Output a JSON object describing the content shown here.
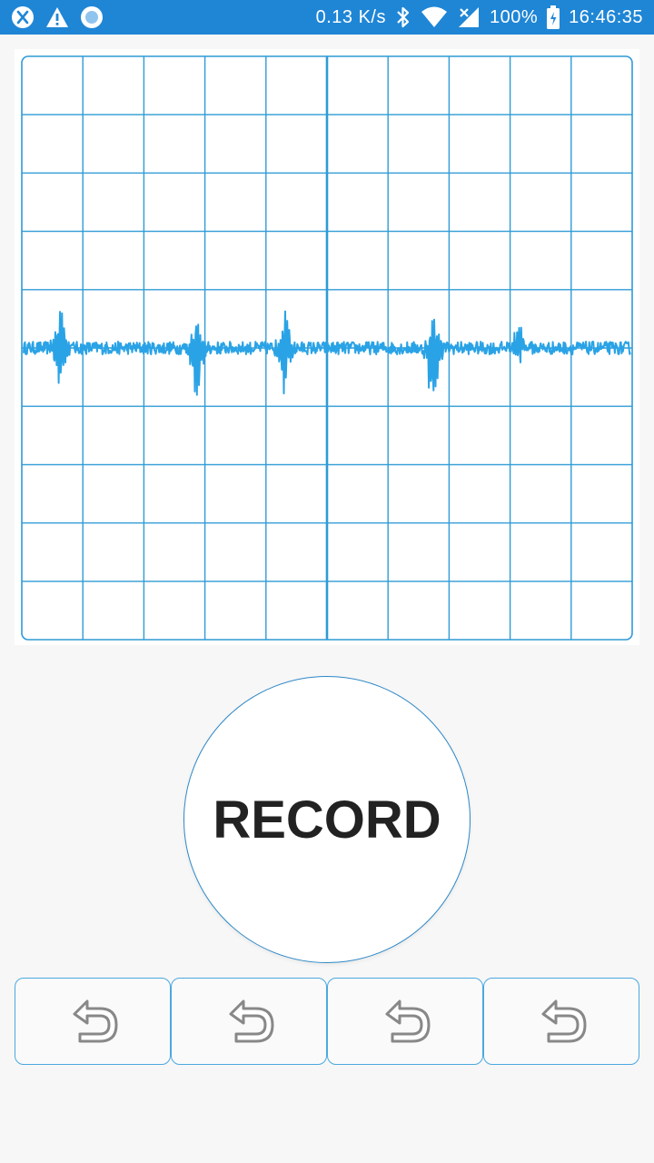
{
  "status_bar": {
    "left_icons": [
      "app-badge-icon",
      "warning-icon",
      "record-dot-icon"
    ],
    "network_speed": "0.13 K/s",
    "right_icons": [
      "bluetooth-icon",
      "wifi-icon",
      "signal-icon"
    ],
    "battery": "100%",
    "time": "16:46:35",
    "color": "#1f86d6"
  },
  "oscilloscope": {
    "grid_columns": 10,
    "grid_rows": 10,
    "trace_color": "#2aa3e6",
    "grid_color": "#2e9bd6",
    "spikes": [
      {
        "t": 0.06,
        "up": 0.78,
        "down": 0.62
      },
      {
        "t": 0.285,
        "up": 0.47,
        "down": 1.15
      },
      {
        "t": 0.43,
        "up": 0.64,
        "down": 0.58
      },
      {
        "t": 0.675,
        "up": 0.45,
        "down": 1.22
      },
      {
        "t": 0.815,
        "up": 0.45,
        "down": 0.28
      }
    ]
  },
  "record_button": {
    "label": "RECORD"
  },
  "undo_buttons": [
    {
      "icon": "undo-icon"
    },
    {
      "icon": "undo-icon"
    },
    {
      "icon": "undo-icon"
    },
    {
      "icon": "undo-icon"
    }
  ]
}
